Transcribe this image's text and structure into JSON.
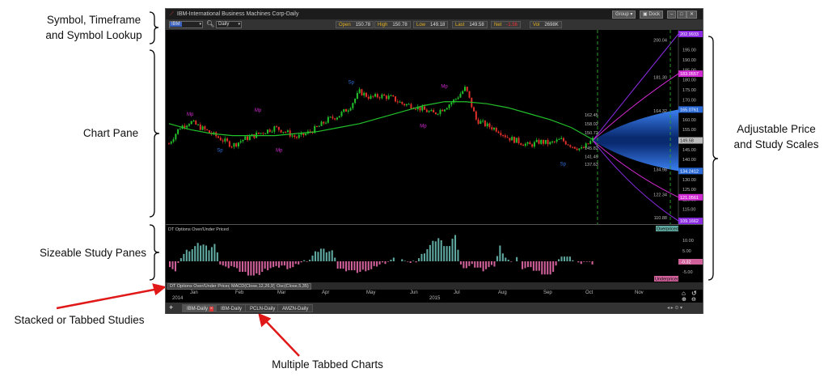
{
  "annotations": {
    "symbol": [
      "Symbol, Timeframe",
      "and Symbol Lookup"
    ],
    "chart_pane": "Chart Pane",
    "scales": [
      "Adjustable Price",
      "and Study Scales"
    ],
    "study_panes": "Sizeable Study Panes",
    "stacked": "Stacked or Tabbed Studies",
    "tabbed": "Multiple Tabbed Charts"
  },
  "window": {
    "title": "IBM-International Business Machines Corp-Daily",
    "group": "Group",
    "dock": "Dock"
  },
  "toolbar": {
    "symbol": "IBM",
    "timeframe": "Daily",
    "quotes": [
      {
        "label": "Open",
        "value": "150.78"
      },
      {
        "label": "High",
        "value": "150.78"
      },
      {
        "label": "Low",
        "value": "149.18"
      },
      {
        "label": "Last",
        "value": "149.58"
      },
      {
        "label": "Net",
        "value": "-1.56"
      },
      {
        "label": "Vol",
        "value": "2698K"
      }
    ]
  },
  "colors": {
    "up": "#22c02a",
    "down": "#e0302a",
    "ma": "#22c02a",
    "fan": "#1e64d0",
    "outer": "#8a2be2",
    "inner": "#d22ad2",
    "hist_pos": "#5fa8a0",
    "hist_neg": "#d0609a"
  },
  "price_axis": {
    "ticks": [
      "195.00",
      "190.00",
      "185.00",
      "180.00",
      "175.00",
      "170.00",
      "165.00",
      "160.00",
      "155.00",
      "150.00",
      "145.00",
      "140.00",
      "135.00",
      "130.00",
      "125.00",
      "120.00",
      "115.00",
      "110.00"
    ],
    "tags": [
      {
        "text": "202.9933",
        "value": 202.99,
        "color": "#8a2be2"
      },
      {
        "text": "183.0557",
        "value": 183.06,
        "color": "#d22ad2"
      },
      {
        "text": "165.0761",
        "value": 165.08,
        "color": "#2a6ad8"
      },
      {
        "text": "149.58",
        "value": 149.58,
        "color": "#bbbbbb"
      },
      {
        "text": "134.2412",
        "value": 134.24,
        "color": "#2a6ad8"
      },
      {
        "text": "121.0561",
        "value": 121.06,
        "color": "#d22ad2"
      },
      {
        "text": "109.1662",
        "value": 109.17,
        "color": "#8a2be2"
      }
    ],
    "inner_labels": [
      {
        "text": "200.04",
        "value": 200.04
      },
      {
        "text": "181.30",
        "value": 181.3
      },
      {
        "text": "164.32",
        "value": 164.32
      },
      {
        "text": "134.98",
        "value": 134.98
      },
      {
        "text": "122.34",
        "value": 122.34
      },
      {
        "text": "110.88",
        "value": 110.88
      }
    ],
    "near_labels": [
      {
        "text": "162.45",
        "value": 162.45
      },
      {
        "text": "158.02",
        "value": 158.02
      },
      {
        "text": "150.72",
        "value": 153.5
      },
      {
        "text": "145.82",
        "value": 145.82
      },
      {
        "text": "141.49",
        "value": 141.49
      },
      {
        "text": "137.63",
        "value": 137.63
      }
    ]
  },
  "price_path": [
    148,
    156,
    159,
    156,
    153,
    150,
    147,
    150,
    152,
    154,
    156,
    154,
    151,
    153,
    156,
    160,
    162,
    166,
    174,
    171,
    172,
    171,
    168,
    167,
    165,
    163,
    166,
    170,
    176,
    160,
    157,
    155,
    151,
    149,
    147,
    149,
    148,
    150,
    147,
    145,
    150
  ],
  "ma_path": [
    158,
    155,
    153,
    152,
    152,
    152,
    153,
    154,
    156,
    158,
    161,
    164,
    167,
    169,
    169,
    168,
    166,
    163,
    160,
    156,
    150
  ],
  "markers": [
    {
      "t": "Mp",
      "x": 0.05,
      "v": 162,
      "c": "#d22ad2"
    },
    {
      "t": "Sp",
      "x": 0.12,
      "v": 144,
      "c": "#3070e0"
    },
    {
      "t": "Mp",
      "x": 0.21,
      "v": 164,
      "c": "#d22ad2"
    },
    {
      "t": "Mp",
      "x": 0.26,
      "v": 144,
      "c": "#d22ad2"
    },
    {
      "t": "Sp",
      "x": 0.43,
      "v": 178,
      "c": "#3070e0"
    },
    {
      "t": "Mp",
      "x": 0.6,
      "v": 156,
      "c": "#d22ad2"
    },
    {
      "t": "Mp",
      "x": 0.65,
      "v": 176,
      "c": "#d22ad2"
    },
    {
      "t": "Sp",
      "x": 0.93,
      "v": 137,
      "c": "#3070e0"
    }
  ],
  "study": {
    "title": "DT Options Over/Under Priced",
    "overpriced": "Overpriced",
    "underpriced": "Underpriced",
    "ticks": [
      "10.00",
      "5.00",
      "-5.00"
    ],
    "current": "-0.32",
    "values": [
      -2,
      -5,
      2,
      5,
      6,
      8,
      8,
      6,
      8,
      -1,
      -3,
      -2,
      -4,
      -5,
      -6,
      -7,
      -6,
      -4,
      -3,
      -3,
      -2,
      -3,
      -3,
      -1,
      0,
      1,
      4,
      6,
      5,
      5,
      -3,
      -4,
      -4,
      -5,
      -5,
      -4,
      -4,
      -2,
      -1,
      0,
      1,
      0,
      1,
      -1,
      0,
      3,
      6,
      9,
      11,
      8,
      7,
      13,
      -2,
      -3,
      -2,
      -3,
      -4,
      -3,
      -2,
      7,
      2,
      -1,
      2,
      -3,
      -3,
      -4,
      -5,
      -6,
      -7,
      -2,
      3,
      2,
      1,
      -1,
      0,
      -1
    ],
    "tabs": [
      "DT Options Over/Under Priced",
      "MACD(Close,12,26,9)",
      "Osc(Close,5,35)"
    ]
  },
  "dates": {
    "months": [
      "Jan",
      "Feb",
      "Mar",
      "Apr",
      "May",
      "Jun",
      "Jul",
      "Aug",
      "Sep",
      "Oct",
      "Nov"
    ],
    "years": [
      "2014",
      "2015"
    ]
  },
  "chart_tabs": [
    "IBM-Daily",
    "IBM-Daily",
    "PCLN-Daily",
    "AMZN-Daily"
  ]
}
